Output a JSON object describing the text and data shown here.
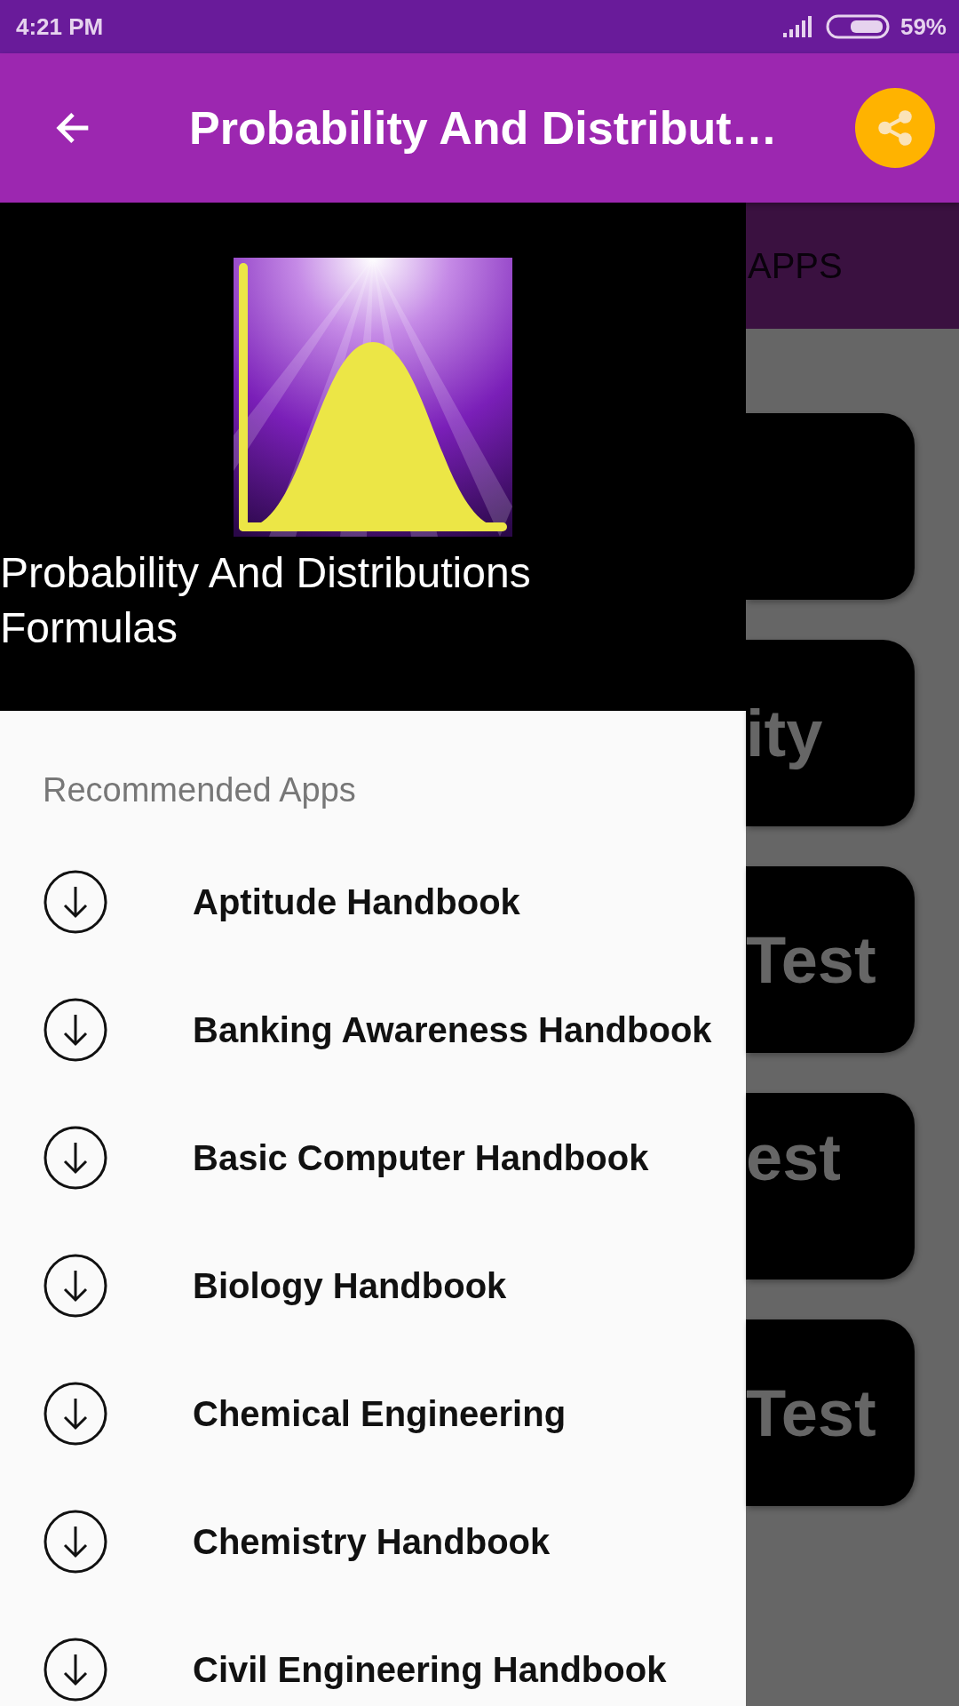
{
  "status_bar": {
    "time": "4:21 PM",
    "battery": "59%"
  },
  "app_bar": {
    "title": "Probability And Distribut…"
  },
  "tabs": [
    {
      "label": "APPS"
    }
  ],
  "background_cards": [
    {
      "kind": "blank"
    },
    {
      "kind": "label",
      "text": "ity"
    },
    {
      "kind": "label",
      "text": "Test"
    },
    {
      "kind": "label",
      "text": "est"
    },
    {
      "kind": "label",
      "text": "Test"
    }
  ],
  "drawer": {
    "app_name": "Probability And Distributions Formulas",
    "section": "Recommended Apps",
    "items": [
      {
        "label": "Aptitude Handbook"
      },
      {
        "label": "Banking Awareness Handbook"
      },
      {
        "label": "Basic Computer Handbook"
      },
      {
        "label": "Biology Handbook"
      },
      {
        "label": "Chemical Engineering"
      },
      {
        "label": "Chemistry Handbook"
      },
      {
        "label": "Civil Engineering Handbook"
      }
    ]
  }
}
